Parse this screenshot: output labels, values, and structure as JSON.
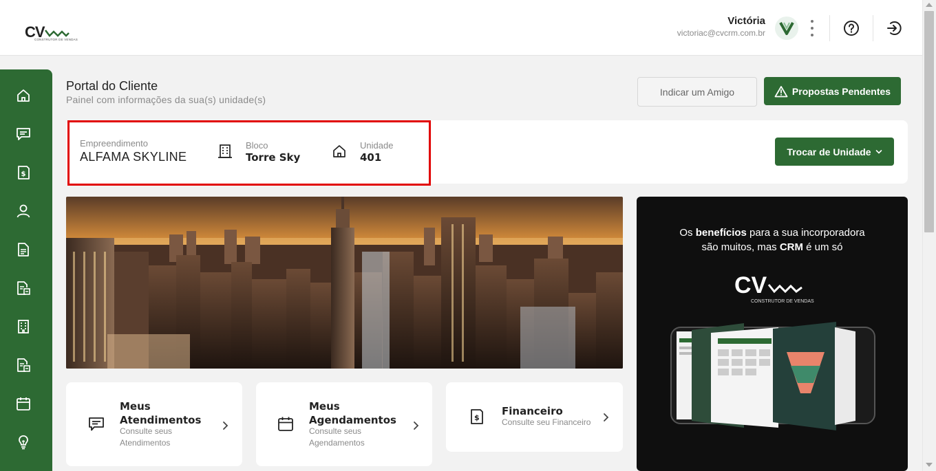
{
  "header": {
    "logo_text": "CV",
    "logo_subtext": "CONSTRUTOR DE VENDAS",
    "user_name": "Victória",
    "user_email": "victoriac@cvcrm.com.br",
    "avatar_letter": "V"
  },
  "sidebar": {
    "items": [
      {
        "icon": "home-icon"
      },
      {
        "icon": "chat-icon"
      },
      {
        "icon": "finance-icon"
      },
      {
        "icon": "user-icon"
      },
      {
        "icon": "document-icon"
      },
      {
        "icon": "document-search-icon"
      },
      {
        "icon": "building-icon"
      },
      {
        "icon": "document-search-icon"
      },
      {
        "icon": "calendar-icon"
      },
      {
        "icon": "bulb-icon"
      }
    ]
  },
  "page": {
    "title": "Portal do Cliente",
    "subtitle": "Painel com informações da sua(s) unidade(s)",
    "indicar_label": "Indicar um Amigo",
    "propostas_label": "Propostas Pendentes"
  },
  "unit": {
    "empreendimento_label": "Empreendimento",
    "empreendimento_value": "ALFAMA SKYLINE",
    "bloco_label": "Bloco",
    "bloco_value": "Torre Sky",
    "unidade_label": "Unidade",
    "unidade_value": "401",
    "trocar_label": "Trocar de Unidade"
  },
  "promo": {
    "line1_pre": "Os ",
    "line1_bold": "benefícios",
    "line1_post": " para a sua incorporadora",
    "line2_pre": "são muitos, mas ",
    "line2_bold": "CRM",
    "line2_post": " é um só",
    "logo_text": "CV",
    "logo_subtext": "CONSTRUTOR DE VENDAS"
  },
  "cards": [
    {
      "title": "Meus Atendimentos",
      "subtitle": "Consulte seus Atendimentos",
      "icon": "chat-icon"
    },
    {
      "title": "Meus Agendamentos",
      "subtitle": "Consulte seus Agendamentos",
      "icon": "calendar-icon"
    },
    {
      "title": "Financeiro",
      "subtitle": "Consulte seu Financeiro",
      "icon": "finance-icon"
    }
  ],
  "colors": {
    "brand_green": "#2d6a33",
    "highlight_red": "#e10000"
  }
}
